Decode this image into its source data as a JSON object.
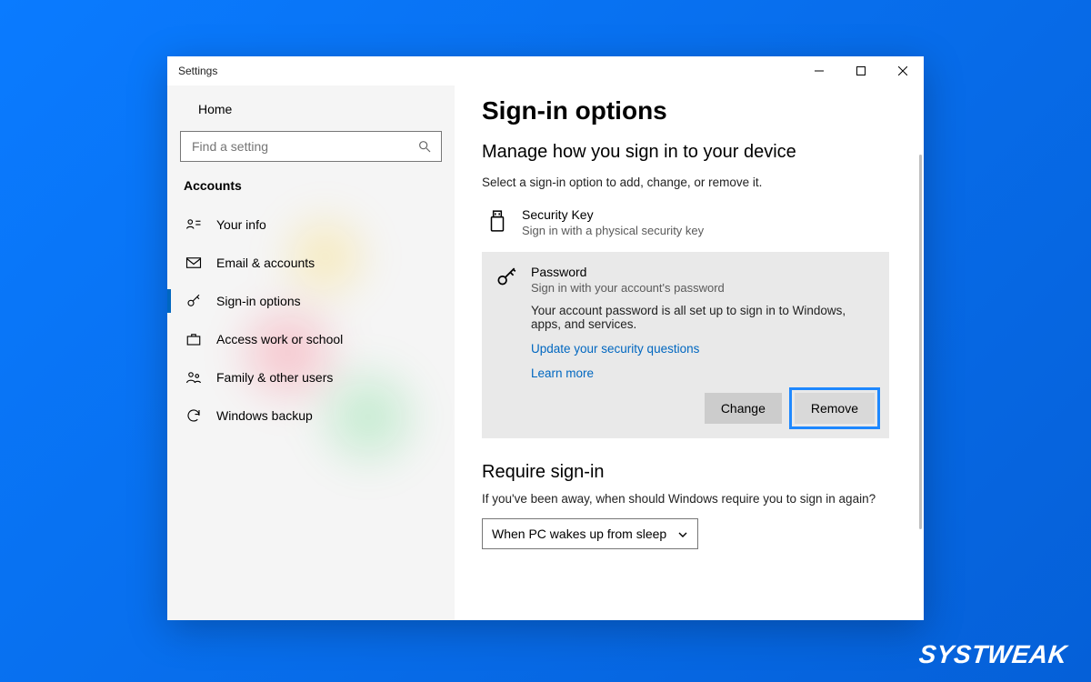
{
  "window": {
    "title": "Settings"
  },
  "sidebar": {
    "home": "Home",
    "search_placeholder": "Find a setting",
    "section": "Accounts",
    "items": [
      {
        "label": "Your info"
      },
      {
        "label": "Email & accounts"
      },
      {
        "label": "Sign-in options"
      },
      {
        "label": "Access work or school"
      },
      {
        "label": "Family & other users"
      },
      {
        "label": "Windows backup"
      }
    ]
  },
  "main": {
    "title": "Sign-in options",
    "subtitle": "Manage how you sign in to your device",
    "hint": "Select a sign-in option to add, change, or remove it.",
    "security_key": {
      "title": "Security Key",
      "sub": "Sign in with a physical security key"
    },
    "password": {
      "title": "Password",
      "sub": "Sign in with your account's password",
      "status": "Your account password is all set up to sign in to Windows, apps, and services.",
      "link_questions": "Update your security questions",
      "link_learn": "Learn more",
      "btn_change": "Change",
      "btn_remove": "Remove"
    },
    "require": {
      "title": "Require sign-in",
      "question": "If you've been away, when should Windows require you to sign in again?",
      "selected": "When PC wakes up from sleep"
    }
  },
  "watermark": "SYSTWEAK"
}
